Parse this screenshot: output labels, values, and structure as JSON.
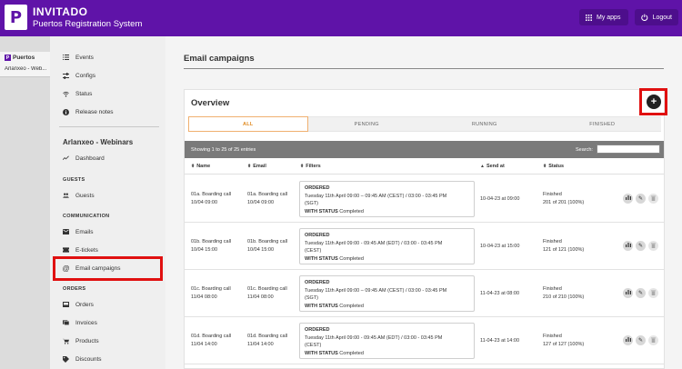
{
  "app": {
    "logo_letter": "P",
    "name": "INVITADO",
    "subtitle": "Puertos Registration System",
    "my_apps": "My apps",
    "logout": "Logout"
  },
  "strip": {
    "tag": "Puertos",
    "title": "Arlanxeo - Web..."
  },
  "sidebar": {
    "top_items": [
      {
        "label": "Events",
        "icon": "list-icon"
      },
      {
        "label": "Configs",
        "icon": "sliders-icon"
      },
      {
        "label": "Status",
        "icon": "wifi-icon"
      },
      {
        "label": "Release notes",
        "icon": "info-icon"
      }
    ],
    "group_title": "Arlanxeo - Webinars",
    "dashboard": "Dashboard",
    "sections": {
      "guests": "GUESTS",
      "communication": "COMMUNICATION",
      "orders": "ORDERS"
    },
    "guests_item": "Guests",
    "comm_items": [
      "Emails",
      "E-tickets",
      "Email campaigns"
    ],
    "order_items": [
      "Orders",
      "Invoices",
      "Products",
      "Discounts"
    ]
  },
  "main": {
    "title": "Email campaigns",
    "overview": "Overview",
    "add_symbol": "+",
    "tabs": [
      "ALL",
      "PENDING",
      "RUNNING",
      "FINISHED"
    ],
    "showing": "Showing 1 to 25 of 25 entries",
    "search_label": "Search:",
    "search_value": "",
    "columns": [
      "Name",
      "Email",
      "Filters",
      "Send at",
      "Status"
    ],
    "rows": [
      {
        "name1": "01a. Boarding call",
        "name2": "10/04 09:00",
        "email1": "01a. Boarding call",
        "email2": "10/04 09:00",
        "f_head": "ORDERED",
        "f_line1": "Tuesday 11th April 09:00 – 09:45 AM (CEST) / 03:00 - 03:45 PM",
        "f_line2": "(SGT)",
        "f_status_label": "WITH STATUS",
        "f_status": "Completed",
        "send_at": "10-04-23 at 09:00",
        "status1": "Finished",
        "status2": "201 of 201 (100%)"
      },
      {
        "name1": "01b. Boarding call",
        "name2": "10/04 15:00",
        "email1": "01b. Boarding call",
        "email2": "10/04 15:00",
        "f_head": "ORDERED",
        "f_line1": "Tuesday 11th April 09:00 - 09:45 AM (EDT) / 03:00 - 03:45 PM",
        "f_line2": "(CEST)",
        "f_status_label": "WITH STATUS",
        "f_status": "Completed",
        "send_at": "10-04-23 at 15:00",
        "status1": "Finished",
        "status2": "121 of 121 (100%)"
      },
      {
        "name1": "01c. Boarding call",
        "name2": "11/04 08:00",
        "email1": "01c. Boarding call",
        "email2": "11/04 08:00",
        "f_head": "ORDERED",
        "f_line1": "Tuesday 11th April 09:00 – 09:45 AM (CEST) / 03:00 - 03:45 PM",
        "f_line2": "(SGT)",
        "f_status_label": "WITH STATUS",
        "f_status": "Completed",
        "send_at": "11-04-23 at 08:00",
        "status1": "Finished",
        "status2": "210 of 210 (100%)"
      },
      {
        "name1": "01d. Boarding call",
        "name2": "11/04 14:00",
        "email1": "01d. Boarding call",
        "email2": "11/04 14:00",
        "f_head": "ORDERED",
        "f_line1": "Tuesday 11th April 09:00 - 09:45 AM (EDT) / 03:00 - 03:45 PM",
        "f_line2": "(CEST)",
        "f_status_label": "WITH STATUS",
        "f_status": "Completed",
        "send_at": "11-04-23 at 14:00",
        "status1": "Finished",
        "status2": "127 of 127 (100%)"
      }
    ]
  },
  "colors": {
    "brand": "#5f13a8",
    "highlight": "#e01010",
    "active_tab": "#e08a20"
  }
}
